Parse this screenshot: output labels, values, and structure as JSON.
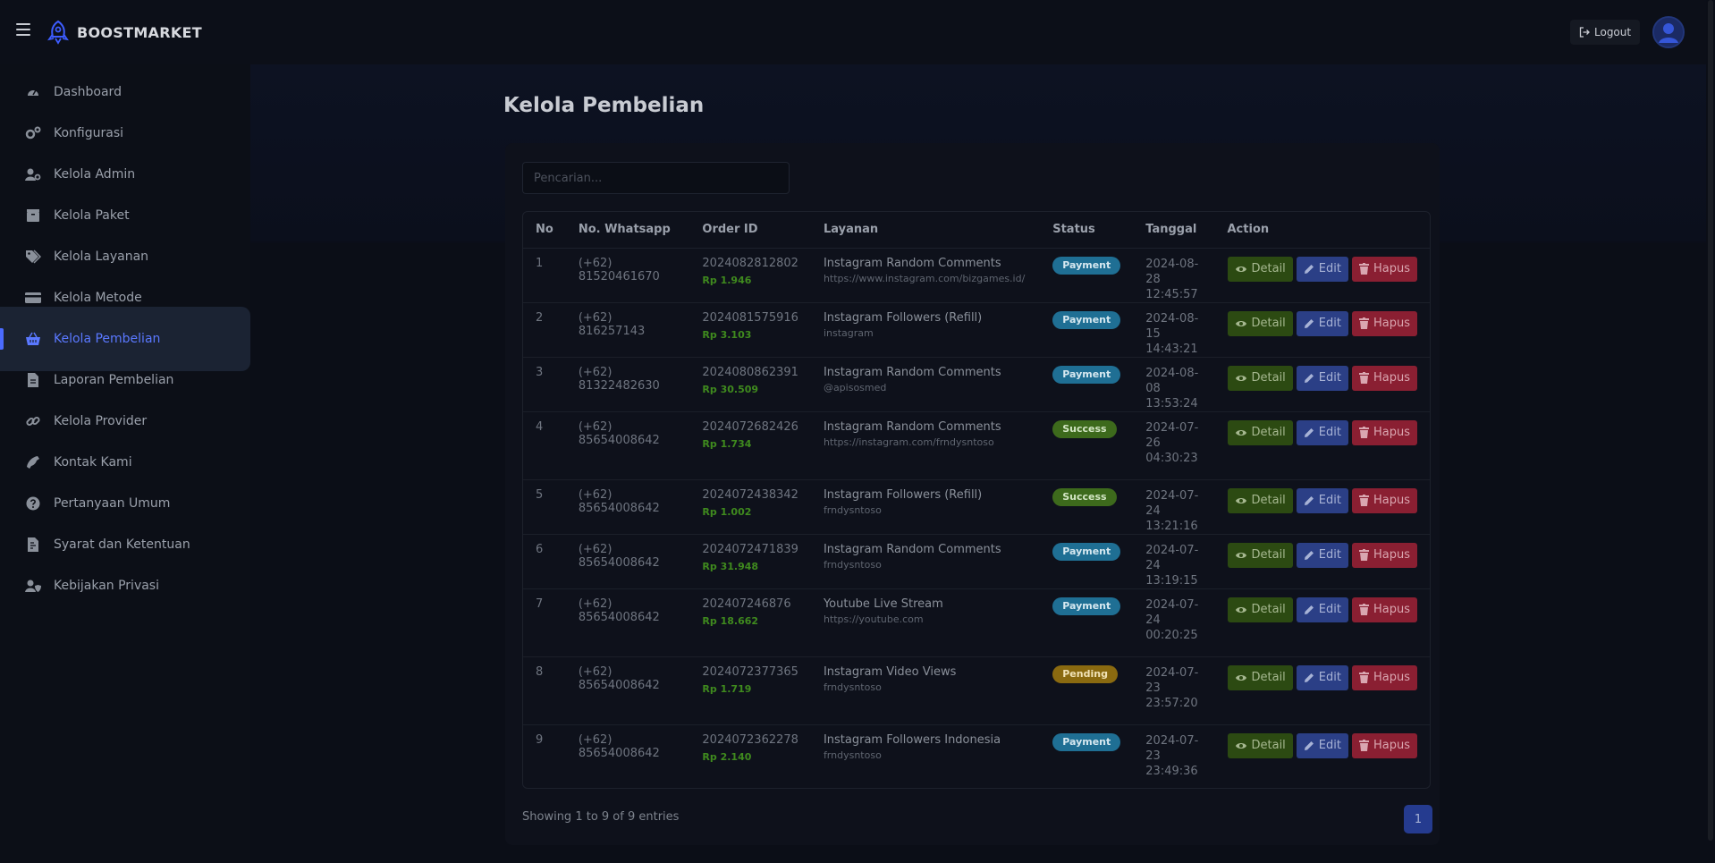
{
  "brand": {
    "name": "BOOSTMARKET"
  },
  "header": {
    "logout_label": "Logout"
  },
  "sidebar": {
    "items": [
      {
        "label": "Dashboard",
        "icon": "gauge-icon"
      },
      {
        "label": "Konfigurasi",
        "icon": "gears-icon"
      },
      {
        "label": "Kelola Admin",
        "icon": "user-gear-icon"
      },
      {
        "label": "Kelola Paket",
        "icon": "box-icon"
      },
      {
        "label": "Kelola Layanan",
        "icon": "tags-icon"
      },
      {
        "label": "Kelola Metode",
        "icon": "credit-card-icon"
      },
      {
        "label": "Kelola Pembelian",
        "icon": "basket-icon",
        "active": true
      },
      {
        "label": "Laporan Pembelian",
        "icon": "file-icon"
      },
      {
        "label": "Kelola Provider",
        "icon": "link-icon"
      },
      {
        "label": "Kontak Kami",
        "icon": "phone-icon"
      },
      {
        "label": "Pertanyaan Umum",
        "icon": "question-circle-icon"
      },
      {
        "label": "Syarat dan Ketentuan",
        "icon": "file-contract-icon"
      },
      {
        "label": "Kebijakan Privasi",
        "icon": "user-shield-icon"
      }
    ]
  },
  "main": {
    "title": "Kelola Pembelian",
    "search_placeholder": "Pencarian...",
    "columns": [
      "No",
      "No. Whatsapp",
      "Order ID",
      "Layanan",
      "Status",
      "Tanggal",
      "Action"
    ],
    "rows": [
      {
        "no": "1",
        "phone": "(+62) 81520461670",
        "order_id": "2024082812802",
        "price": "Rp 1.946",
        "service": "Instagram Random Comments",
        "target": "https://www.instagram.com/bizgames.id/",
        "status": "Payment",
        "status_type": "payment",
        "date_lines": [
          "2024-08-",
          "28 12:45:57"
        ]
      },
      {
        "no": "2",
        "phone": "(+62) 816257143",
        "order_id": "2024081575916",
        "price": "Rp 3.103",
        "service": "Instagram Followers (Refill)",
        "target": "instagram",
        "status": "Payment",
        "status_type": "payment",
        "date_lines": [
          "2024-08-",
          "15 14:43:21"
        ]
      },
      {
        "no": "3",
        "phone": "(+62) 81322482630",
        "order_id": "2024080862391",
        "price": "Rp 30.509",
        "service": "Instagram Random Comments",
        "target": "@apisosmed",
        "status": "Payment",
        "status_type": "payment",
        "date_lines": [
          "2024-08-",
          "08 13:53:24"
        ]
      },
      {
        "no": "4",
        "phone": "(+62) 85654008642",
        "order_id": "2024072682426",
        "price": "Rp 1.734",
        "service": "Instagram Random Comments",
        "target": "https://instagram.com/frndysntoso",
        "status": "Success",
        "status_type": "success",
        "date_lines": [
          "2024-07-",
          "26",
          "04:30:23"
        ]
      },
      {
        "no": "5",
        "phone": "(+62) 85654008642",
        "order_id": "2024072438342",
        "price": "Rp 1.002",
        "service": "Instagram Followers (Refill)",
        "target": "frndysntoso",
        "status": "Success",
        "status_type": "success",
        "date_lines": [
          "2024-07-",
          "24 13:21:16"
        ]
      },
      {
        "no": "6",
        "phone": "(+62) 85654008642",
        "order_id": "2024072471839",
        "price": "Rp 31.948",
        "service": "Instagram Random Comments",
        "target": "frndysntoso",
        "status": "Payment",
        "status_type": "payment",
        "date_lines": [
          "2024-07-",
          "24 13:19:15"
        ]
      },
      {
        "no": "7",
        "phone": "(+62) 85654008642",
        "order_id": "202407246876",
        "price": "Rp 18.662",
        "service": "Youtube Live Stream",
        "target": "https://youtube.com",
        "status": "Payment",
        "status_type": "payment",
        "date_lines": [
          "2024-07-",
          "24",
          "00:20:25"
        ]
      },
      {
        "no": "8",
        "phone": "(+62) 85654008642",
        "order_id": "2024072377365",
        "price": "Rp 1.719",
        "service": "Instagram Video Views",
        "target": "frndysntoso",
        "status": "Pending",
        "status_type": "pending",
        "date_lines": [
          "2024-07-",
          "23",
          "23:57:20"
        ]
      },
      {
        "no": "9",
        "phone": "(+62) 85654008642",
        "order_id": "2024072362278",
        "price": "Rp 2.140",
        "service": "Instagram Followers Indonesia",
        "target": "frndysntoso",
        "status": "Payment",
        "status_type": "payment",
        "date_lines": [
          "2024-07-",
          "23",
          "23:49:36"
        ]
      }
    ],
    "action_labels": {
      "detail": "Detail",
      "edit": "Edit",
      "hapus": "Hapus"
    },
    "footer_text": "Showing 1 to 9 of 9 entries",
    "current_page": "1"
  },
  "colors": {
    "accent": "#4b6bff",
    "payment": "#1f6f94",
    "success": "#3d6a1c",
    "pending": "#8a6a10",
    "detail": "#2c4a12",
    "edit": "#2b3f86",
    "hapus": "#8a1f32"
  }
}
